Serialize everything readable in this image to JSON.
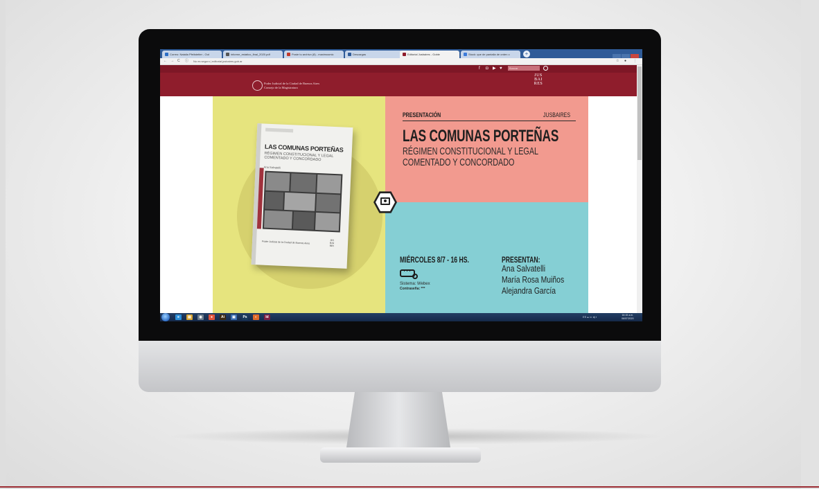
{
  "browser": {
    "tabs": [
      {
        "label": "Correo: Natalia Pfeilstetter - Out"
      },
      {
        "label": "informe_estatico_final_2020.pdf"
      },
      {
        "label": "Poste tu archivo (8) - maximusmic"
      },
      {
        "label": "Descargas"
      },
      {
        "label": "Editorial Jusbaires - Gobie"
      },
      {
        "label": "Stock: que de pantalla de orden c"
      }
    ],
    "new_tab": "+",
    "nav": {
      "back": "←",
      "forward": "→",
      "reload": "C",
      "info": "ⓘ"
    },
    "url": "No es seguro | editorial.jusbaires.gob.ar",
    "extensions": {
      "star": "☆",
      "profile": "●",
      "menu": "⋮"
    }
  },
  "site_header": {
    "social": [
      "f",
      "◘",
      "▶",
      "♥"
    ],
    "search_placeholder": "Buscar",
    "logo_text_line1": "Poder Judicial de la Ciudad de Buenos Aires",
    "logo_text_line2": "Consejo de la Magistratura",
    "jus_logo": [
      "JUS",
      "BAI",
      "RES"
    ]
  },
  "flyer": {
    "presentacion": "PRESENTACIÓN",
    "brand": "JUSBAIRES",
    "title": "LAS COMUNAS PORTEÑAS",
    "subtitle_line1": "RÉGIMEN CONSTITUCIONAL Y LEGAL",
    "subtitle_line2": "COMENTADO Y CONCORDADO",
    "date_time": "MIÉRCOLES 8/7 - 16 HS.",
    "sistema": "Sistema: Webex",
    "contrasena": "Contraseña: ***",
    "presentan_label": "PRESENTAN:",
    "presenters": [
      "Ana Salvatelli",
      "María Rosa Muiños",
      "Alejandra García"
    ],
    "book": {
      "title": "LAS COMUNAS PORTEÑAS",
      "subtitle": "RÉGIMEN CONSTITUCIONAL Y LEGAL COMENTADO Y CONCORDADO",
      "author": "Ana Salvatelli",
      "publisher": "Poder Judicial de la Ciudad de Buenos Aires",
      "logo": [
        "JUS",
        "BAI",
        "RES"
      ]
    }
  },
  "taskbar": {
    "apps": [
      {
        "label": "e",
        "color": "#2c8fd8"
      },
      {
        "label": "▤",
        "color": "#d9a431"
      },
      {
        "label": "◉",
        "color": "#6c7b8a"
      },
      {
        "label": "●",
        "color": "#e0533a"
      },
      {
        "label": "Ai",
        "color": "#3d2a10"
      },
      {
        "label": "▣",
        "color": "#3b6db0"
      },
      {
        "label": "Ps",
        "color": "#1a3a5a"
      },
      {
        "label": "◐",
        "color": "#e06a2a"
      },
      {
        "label": "Id",
        "color": "#7c1e42"
      }
    ],
    "tray": "ES ▴ ▭ ◂) ▪",
    "time": "16:15 a.m.",
    "date": "06/07/2020"
  },
  "colors": {
    "header": "#8f1d2c",
    "flyer_yellow": "#e6e47e",
    "flyer_pink": "#f29a8f",
    "flyer_cyan": "#85cfd4",
    "accent_bottom_line": "#9b2b32"
  }
}
